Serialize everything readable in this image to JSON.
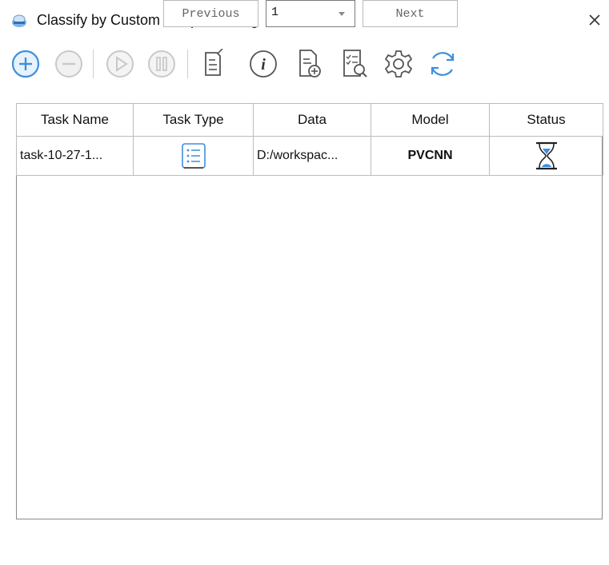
{
  "window": {
    "title": "Classify by Custom Deep Learning"
  },
  "colors": {
    "accent_blue": "#3d8fe0",
    "disabled_gray": "#c9c9c9",
    "icon_dark": "#555555"
  },
  "toolbar": {
    "icons": [
      "add-icon",
      "remove-icon",
      "play-icon",
      "pause-icon",
      "edit-document-icon",
      "info-icon",
      "add-file-icon",
      "review-list-icon",
      "settings-icon",
      "refresh-icon"
    ]
  },
  "table": {
    "columns": [
      "Task Name",
      "Task Type",
      "Data",
      "Model",
      "Status"
    ],
    "rows": [
      {
        "task_name": "task-10-27-1...",
        "task_type_icon": "list-icon",
        "data": "D:/workspac...",
        "model": "PVCNN",
        "status_icon": "hourglass-icon"
      }
    ]
  },
  "pagination": {
    "previous_label": "Previous",
    "page_value": "1",
    "next_label": "Next"
  }
}
